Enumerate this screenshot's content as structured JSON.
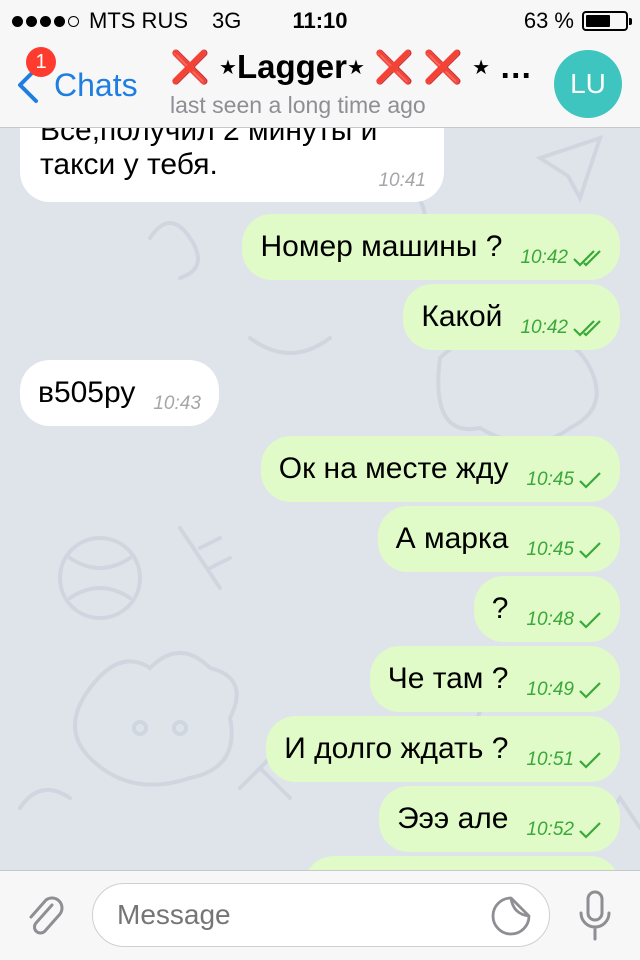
{
  "status_bar": {
    "carrier": "MTS RUS",
    "network": "3G",
    "time": "11:10",
    "battery_text": "63 %",
    "battery_level": 0.63
  },
  "header": {
    "back_label": "Chats",
    "unread_badge": "1",
    "title_name": "Lagger",
    "subtitle": "last seen a long time ago",
    "avatar_initials": "LU"
  },
  "messages": [
    {
      "dir": "in",
      "text": "Все,получил 2 минуты и",
      "text2": "такси у тебя.",
      "time": "10:41",
      "status": ""
    },
    {
      "dir": "out",
      "text": "Номер машины ?",
      "time": "10:42",
      "status": "read"
    },
    {
      "dir": "out",
      "text": "Какой",
      "time": "10:42",
      "status": "read"
    },
    {
      "dir": "in",
      "text": "в505ру",
      "time": "10:43",
      "status": ""
    },
    {
      "dir": "out",
      "text": "Ок на месте жду",
      "time": "10:45",
      "status": "sent"
    },
    {
      "dir": "out",
      "text": "А марка",
      "time": "10:45",
      "status": "sent"
    },
    {
      "dir": "out",
      "text": "?",
      "time": "10:48",
      "status": "sent"
    },
    {
      "dir": "out",
      "text": "Че там ?",
      "time": "10:49",
      "status": "sent"
    },
    {
      "dir": "out",
      "text": "И долго ждать ?",
      "time": "10:51",
      "status": "sent"
    },
    {
      "dir": "out",
      "text": "Эээ але",
      "time": "10:52",
      "status": "sent"
    }
  ],
  "composer": {
    "placeholder": "Message"
  },
  "colors": {
    "accent": "#1e7fe0",
    "outgoing_bubble": "#e0fbc7",
    "incoming_bubble": "#ffffff",
    "check_green": "#3aa83a",
    "badge_red": "#ff3b30",
    "avatar_bg": "#3ec5c0"
  }
}
